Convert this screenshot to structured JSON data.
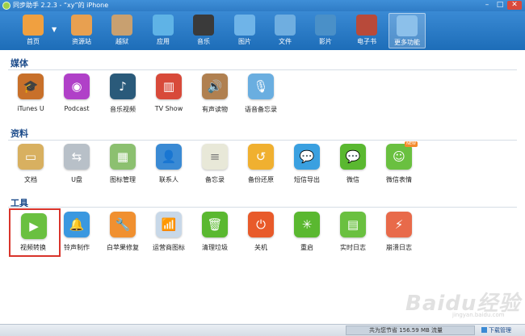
{
  "window": {
    "title": "同步助手 2.2.3 - “xy”的 iPhone",
    "buttons": [
      "–",
      "□",
      "✕"
    ]
  },
  "toolbar": {
    "items": [
      {
        "label": "首页",
        "icon": "home-icon",
        "color": "#f0a040"
      },
      {
        "label": "资源站",
        "icon": "store-icon",
        "color": "#e8a050"
      },
      {
        "label": "越狱",
        "icon": "jailbreak-icon",
        "color": "#c8a070"
      },
      {
        "label": "应用",
        "icon": "apps-icon",
        "color": "#5fb3e6"
      },
      {
        "label": "音乐",
        "icon": "music-icon",
        "color": "#3a3a3a"
      },
      {
        "label": "图片",
        "icon": "photo-icon",
        "color": "#6fb4e8"
      },
      {
        "label": "文件",
        "icon": "folder-icon",
        "color": "#6faee0"
      },
      {
        "label": "影片",
        "icon": "video-icon",
        "color": "#4a90c8"
      },
      {
        "label": "电子书",
        "icon": "ebook-icon",
        "color": "#b84a3a"
      },
      {
        "label": "更多功能",
        "icon": "more-tools-icon",
        "color": "#8cc0ea"
      }
    ]
  },
  "sections": {
    "media": {
      "title": "媒体",
      "apps": [
        {
          "label": "iTunes U",
          "icon": "itunes-u-icon",
          "color": "#c8702a",
          "glyph": "🎓"
        },
        {
          "label": "Podcast",
          "icon": "podcast-icon",
          "color": "#b040c8",
          "glyph": "◉"
        },
        {
          "label": "音乐视频",
          "icon": "music-video-icon",
          "color": "#2a5a7a",
          "glyph": "♪"
        },
        {
          "label": "TV Show",
          "icon": "tv-show-icon",
          "color": "#d84a3a",
          "glyph": "▥"
        },
        {
          "label": "有声读物",
          "icon": "audiobook-icon",
          "color": "#b08050",
          "glyph": "🔊"
        },
        {
          "label": "语音备忘录",
          "icon": "voice-memo-icon",
          "color": "#6aaee0",
          "glyph": "🎙"
        }
      ]
    },
    "data": {
      "title": "资料",
      "apps": [
        {
          "label": "文档",
          "icon": "document-icon",
          "color": "#d8b060",
          "glyph": "▭"
        },
        {
          "label": "U盘",
          "icon": "usb-drive-icon",
          "color": "#b8c0c8",
          "glyph": "⇆"
        },
        {
          "label": "图标管理",
          "icon": "icon-manager-icon",
          "color": "#8cc070",
          "glyph": "▦"
        },
        {
          "label": "联系人",
          "icon": "contacts-icon",
          "color": "#3a8ad4",
          "glyph": "👤"
        },
        {
          "label": "备忘录",
          "icon": "notes-icon",
          "color": "#e8e8d8",
          "glyph": "≡"
        },
        {
          "label": "备份还原",
          "icon": "backup-restore-icon",
          "color": "#f0b030",
          "glyph": "↺"
        },
        {
          "label": "短信导出",
          "icon": "sms-export-icon",
          "color": "#3aa0e0",
          "glyph": "💬"
        },
        {
          "label": "微信",
          "icon": "wechat-icon",
          "color": "#5ab830",
          "glyph": "💬"
        },
        {
          "label": "微信表情",
          "icon": "wechat-sticker-icon",
          "color": "#6ac040",
          "glyph": "☺",
          "badge": "NEW"
        }
      ]
    },
    "tools": {
      "title": "工具",
      "apps": [
        {
          "label": "视频转换",
          "icon": "video-convert-icon",
          "color": "#6ac040",
          "glyph": "▶",
          "highlight": true
        },
        {
          "label": "铃声制作",
          "icon": "ringtone-icon",
          "color": "#3a98e0",
          "glyph": "🔔"
        },
        {
          "label": "白苹果修复",
          "icon": "repair-icon",
          "color": "#f09030",
          "glyph": "🔧"
        },
        {
          "label": "运营商图标",
          "icon": "carrier-icon",
          "color": "#c8d8e8",
          "glyph": "📶"
        },
        {
          "label": "清理垃圾",
          "icon": "trash-clean-icon",
          "color": "#5ab830",
          "glyph": "🗑"
        },
        {
          "label": "关机",
          "icon": "shutdown-icon",
          "color": "#e85a2a",
          "glyph": "⏻"
        },
        {
          "label": "重启",
          "icon": "restart-icon",
          "color": "#5ab830",
          "glyph": "✳"
        },
        {
          "label": "实时日志",
          "icon": "realtime-log-icon",
          "color": "#6ac040",
          "glyph": "▤"
        },
        {
          "label": "崩溃日志",
          "icon": "crash-log-icon",
          "color": "#e86a4a",
          "glyph": "⚡"
        }
      ]
    }
  },
  "watermark": {
    "text": "Baidu经验",
    "sub": "jingyan.baidu.com"
  },
  "status": {
    "storage_text": "共为您节省  156.59 MB 流量",
    "download_manager": "下载管理"
  }
}
